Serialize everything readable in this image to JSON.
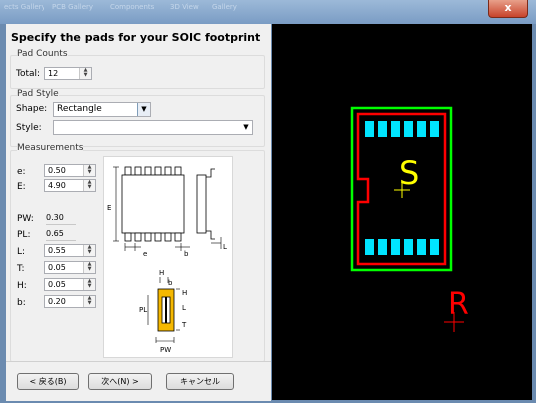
{
  "window": {
    "tabs_ghost": [
      "ects Gallery",
      "PCB Gallery",
      "Components",
      "3D View",
      "Gallery"
    ],
    "close_glyph": "x"
  },
  "wizard": {
    "heading": "Specify the pads for your SOIC footprint",
    "pad_counts": {
      "group_label": "Pad Counts",
      "total_label": "Total:",
      "total_value": "12"
    },
    "pad_style": {
      "group_label": "Pad Style",
      "shape_label": "Shape:",
      "shape_value": "Rectangle",
      "style_label": "Style:",
      "style_value": ""
    },
    "measurements": {
      "group_label": "Measurements",
      "e_label": "e:",
      "e_value": "0.50",
      "E_label": "E:",
      "E_value": "4.90",
      "PW_label": "PW:",
      "PW_value": "0.30",
      "PL_label": "PL:",
      "PL_value": "0.65",
      "L_label": "L:",
      "L_value": "0.55",
      "T_label": "T:",
      "T_value": "0.05",
      "H_label": "H:",
      "H_value": "0.05",
      "b_label": "b:",
      "b_value": "0.20"
    },
    "diagram_labels": {
      "E": "E",
      "e": "e",
      "b": "b",
      "L": "L",
      "H": "H",
      "PL": "PL",
      "T": "T",
      "PW": "PW"
    },
    "buttons": {
      "back": "< 戻る(B)",
      "next": "次へ(N) >",
      "cancel": "キャンセル"
    }
  },
  "preview": {
    "ref_designator": "S",
    "origin_label": "R",
    "colors": {
      "pad": "#00e5ff",
      "outline": "#ff0000",
      "courtyard": "#00ff00",
      "text": "#ffff00"
    }
  }
}
